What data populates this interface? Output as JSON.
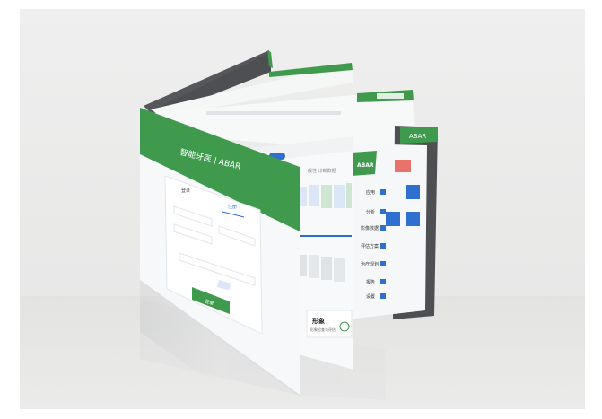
{
  "scene": {
    "subject": "brochure-mockup",
    "colors": {
      "brand_green": "#3f9a4e",
      "page_white": "#f7f8f9",
      "panel_blue": "#2f6fd0",
      "light_green_block": "#cfe6d3",
      "light_blue_block": "#dbe6f6",
      "backdrop": "#ececeb",
      "dark_page": "#4e4f52"
    }
  },
  "front_panel": {
    "header": "智能牙医 | ABAR",
    "tab_left": "登录",
    "tab_right": "注册",
    "login_button": "登录"
  },
  "middle_panel": {
    "search_placeholder": "一般性  诊断数据",
    "footer_title": "形象",
    "footer_subtitle": "形象检查与评估"
  },
  "right_panel": {
    "logo": "ABAR",
    "side_menu": [
      "应用",
      "分析",
      "影像数据",
      "评估方案",
      "治疗规划",
      "报告",
      "设置"
    ]
  }
}
